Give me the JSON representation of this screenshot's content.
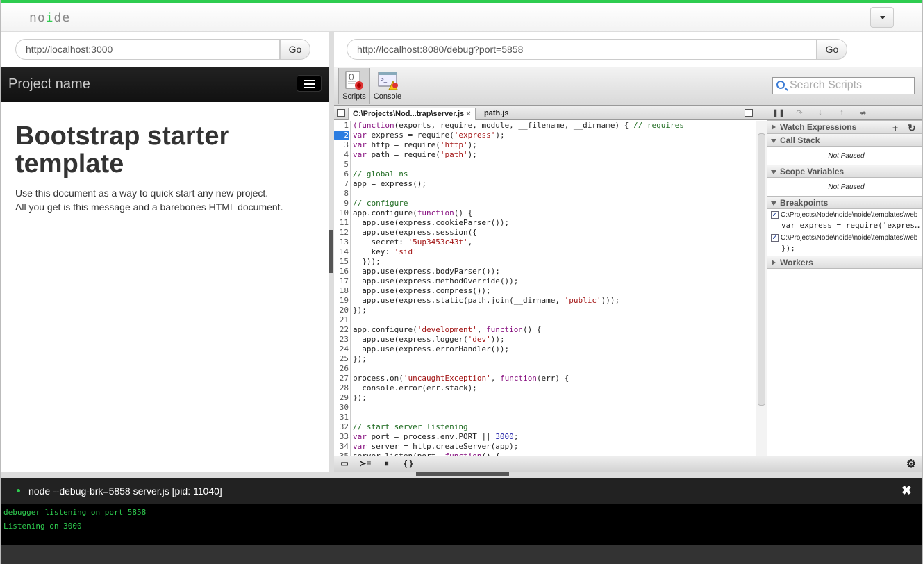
{
  "app": {
    "logo_pre": "no",
    "logo_accent": "i",
    "logo_post": "de",
    "accent_color": "#2ecc4f"
  },
  "left_url": {
    "value": "http://localhost:3000",
    "go_label": "Go"
  },
  "right_url": {
    "value": "http://localhost:8080/debug?port=5858",
    "go_label": "Go"
  },
  "preview": {
    "brand": "Project name",
    "heading": "Bootstrap starter template",
    "lead_1": "Use this document as a way to quick start any new project.",
    "lead_2": "All you get is this message and a barebones HTML document."
  },
  "devtools": {
    "tabs": [
      {
        "label": "Scripts",
        "icon": "scripts-icon"
      },
      {
        "label": "Console",
        "icon": "console-icon"
      }
    ],
    "search_placeholder": "Search Scripts",
    "file_tabs": [
      {
        "label": "C:\\Projects\\Nod...trap\\server.js",
        "close": "×"
      },
      {
        "label": "path.js"
      }
    ],
    "breakpoint_line": 2,
    "code": [
      [
        [
          "kw",
          "(function"
        ],
        [
          "",
          "("
        ],
        [
          "",
          "exports, require, module, __filename, __dirname) { "
        ],
        [
          "cm",
          "// requires"
        ]
      ],
      [
        [
          "kw",
          "var"
        ],
        [
          "",
          " express = require("
        ],
        [
          "str",
          "'express'"
        ],
        [
          "",
          ");"
        ]
      ],
      [
        [
          "kw",
          "var"
        ],
        [
          "",
          " http = require("
        ],
        [
          "str",
          "'http'"
        ],
        [
          "",
          ");"
        ]
      ],
      [
        [
          "kw",
          "var"
        ],
        [
          "",
          " path = require("
        ],
        [
          "str",
          "'path'"
        ],
        [
          "",
          ");"
        ]
      ],
      [],
      [
        [
          "cm",
          "// global ns"
        ]
      ],
      [
        [
          "",
          "app = express();"
        ]
      ],
      [],
      [
        [
          "cm",
          "// configure"
        ]
      ],
      [
        [
          "",
          "app.configure("
        ],
        [
          "kw",
          "function"
        ],
        [
          "",
          "() {"
        ]
      ],
      [
        [
          "",
          "  app.use(express.cookieParser());"
        ]
      ],
      [
        [
          "",
          "  app.use(express.session({"
        ]
      ],
      [
        [
          "",
          "    secret: "
        ],
        [
          "str",
          "'5up3453c43t'"
        ],
        [
          "",
          ","
        ]
      ],
      [
        [
          "",
          "    key: "
        ],
        [
          "str",
          "'sid'"
        ]
      ],
      [
        [
          "",
          "  }));"
        ]
      ],
      [
        [
          "",
          "  app.use(express.bodyParser());"
        ]
      ],
      [
        [
          "",
          "  app.use(express.methodOverride());"
        ]
      ],
      [
        [
          "",
          "  app.use(express.compress());"
        ]
      ],
      [
        [
          "",
          "  app.use(express.static(path.join(__dirname, "
        ],
        [
          "str",
          "'public'"
        ],
        [
          "",
          ")));"
        ]
      ],
      [
        [
          "",
          "});"
        ]
      ],
      [],
      [
        [
          "",
          "app.configure("
        ],
        [
          "str",
          "'development'"
        ],
        [
          "",
          ", "
        ],
        [
          "kw",
          "function"
        ],
        [
          "",
          "() {"
        ]
      ],
      [
        [
          "",
          "  app.use(express.logger("
        ],
        [
          "str",
          "'dev'"
        ],
        [
          "",
          "));"
        ]
      ],
      [
        [
          "",
          "  app.use(express.errorHandler());"
        ]
      ],
      [
        [
          "",
          "});"
        ]
      ],
      [],
      [
        [
          "",
          "process.on("
        ],
        [
          "str",
          "'uncaughtException'"
        ],
        [
          "",
          ", "
        ],
        [
          "kw",
          "function"
        ],
        [
          "",
          "(err) {"
        ]
      ],
      [
        [
          "",
          "  console.error(err.stack);"
        ]
      ],
      [
        [
          "",
          "});"
        ]
      ],
      [],
      [],
      [
        [
          "cm",
          "// start server listening"
        ]
      ],
      [
        [
          "kw",
          "var"
        ],
        [
          "",
          " port = process.env.PORT || "
        ],
        [
          "num",
          "3000"
        ],
        [
          "",
          ";"
        ]
      ],
      [
        [
          "kw",
          "var"
        ],
        [
          "",
          " server = http.createServer(app);"
        ]
      ],
      [
        [
          "",
          "server.listen(port, "
        ],
        [
          "kw",
          "function"
        ],
        [
          "",
          "() {"
        ]
      ]
    ],
    "sections": {
      "watch": "Watch Expressions",
      "callstack": "Call Stack",
      "callstack_status": "Not Paused",
      "scope": "Scope Variables",
      "scope_status": "Not Paused",
      "breakpoints": "Breakpoints",
      "workers": "Workers"
    },
    "breakpoints": [
      {
        "path": "C:\\Projects\\Node\\noide\\noide\\templates\\web",
        "code": "var express = require('express');"
      },
      {
        "path": "C:\\Projects\\Node\\noide\\noide\\templates\\web",
        "code": "});"
      }
    ]
  },
  "console": {
    "process": "node --debug-brk=5858 server.js [pid: 11040]",
    "close": "✖",
    "lines": [
      "debugger listening on port 5858",
      "Listening on 3000"
    ]
  }
}
